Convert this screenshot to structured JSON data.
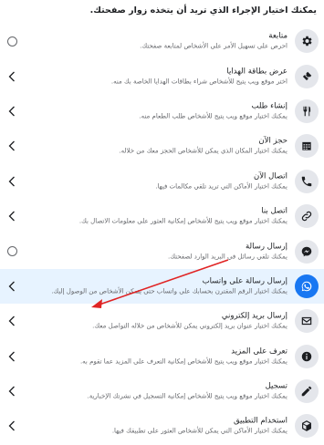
{
  "header": {
    "title": "يمكنك اختيار الإجراء الذي تريد أن يتخذه زوار صفحتك."
  },
  "options": [
    {
      "icon": "gear-icon",
      "control": "radio",
      "title": "متابعة",
      "desc": "احرص على تسهيل الأمر على الأشخاص لمتابعة صفحتك."
    },
    {
      "icon": "ticket-icon",
      "control": "chevron",
      "title": "عرض بطاقة الهدايا",
      "desc": "اختر موقع ويب يتيح للأشخاص شراء بطاقات الهدايا الخاصة بك منه."
    },
    {
      "icon": "fork-knife-icon",
      "control": "chevron",
      "title": "إنشاء طلب",
      "desc": "يمكنك اختيار موقع ويب يتيح للأشخاص طلب الطعام منه."
    },
    {
      "icon": "calendar-icon",
      "control": "chevron",
      "title": "حجز الآن",
      "desc": "يمكنك اختيار المكان الذي يمكن للأشخاص الحجز معك من خلاله."
    },
    {
      "icon": "phone-icon",
      "control": "chevron",
      "title": "اتصال الآن",
      "desc": "يمكنك اختيار الأماكن التي تريد تلقي مكالمات فيها."
    },
    {
      "icon": "link-icon",
      "control": "chevron",
      "title": "اتصل بنا",
      "desc": "يمكنك اختيار موقع ويب يتيح للأشخاص إمكانية العثور على معلومات الاتصال بك."
    },
    {
      "icon": "messenger-icon",
      "control": "radio",
      "title": "إرسال رسالة",
      "desc": "يمكنك تلقي رسائل في البريد الوارد لصفحتك."
    },
    {
      "icon": "whatsapp-icon",
      "control": "chevron",
      "title": "إرسال رسالة على واتساب",
      "desc": "يمكنك اختيار الرقم المقترن بحسابك على واتساب حتى يتمكن الأشخاص من الوصول إليك.",
      "highlight": true
    },
    {
      "icon": "mail-icon",
      "control": "chevron",
      "title": "إرسال بريد إلكتروني",
      "desc": "يمكنك اختيار عنوان بريد إلكتروني يمكن للأشخاص من خلاله التواصل معك."
    },
    {
      "icon": "info-icon",
      "control": "chevron",
      "title": "تعرف على المزيد",
      "desc": "يمكنك اختيار موقع ويب يتيح للأشخاص إمكانية التعرف على المزيد عما تقوم به."
    },
    {
      "icon": "pencil-icon",
      "control": "chevron",
      "title": "تسجيل",
      "desc": "يمكنك اختيار موقع ويب يتيح للأشخاص إمكانية التسجيل في نشرتك الإخبارية."
    },
    {
      "icon": "box-icon",
      "control": "chevron",
      "title": "استخدام التطبيق",
      "desc": "يمكنك اختيار الأماكن التي يمكن للأشخاص العثور على تطبيقك فيها."
    }
  ],
  "colors": {
    "accent": "#1877f2",
    "highlight_bg": "#e7f3ff",
    "annotation_arrow": "#e02424"
  }
}
